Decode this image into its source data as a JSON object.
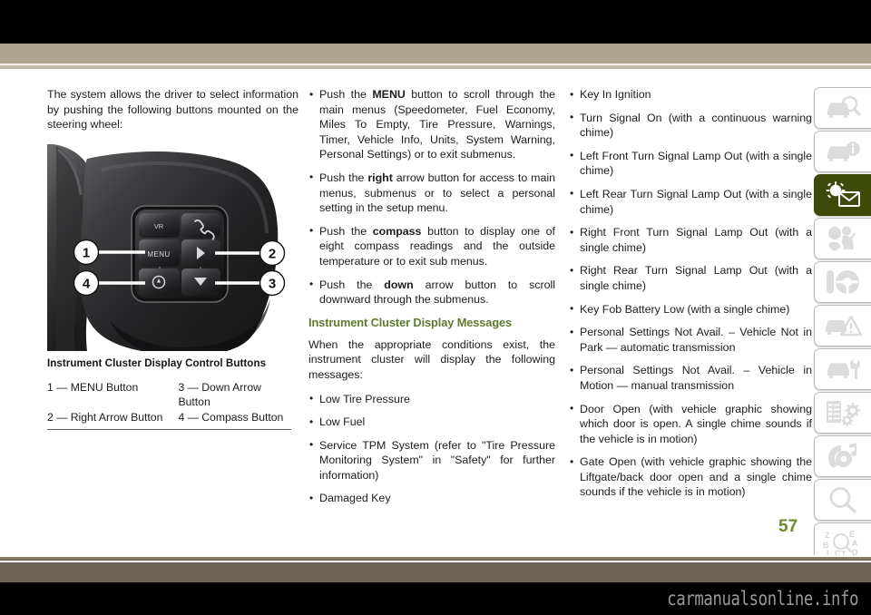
{
  "viewer": {
    "watermark": "carmanualsonline.info",
    "page_number": "57",
    "accent_green": "#5f7a2e",
    "band_color": "#ada592",
    "footer_band_color": "#6c6454",
    "active_tab_color": "#3d4a0a"
  },
  "column1": {
    "intro": "The system allows the driver to select information by pushing the following buttons mounted on the steering wheel:",
    "figure": {
      "alt": "steering-wheel-control-buttons",
      "callouts": [
        "1",
        "2",
        "3",
        "4"
      ],
      "menu_label": "MENU"
    },
    "caption": "Instrument Cluster Display Control Buttons",
    "legend": [
      {
        "left": "1 — MENU Button",
        "right": "3 — Down Arrow Button"
      },
      {
        "left": "2 — Right Arrow Button",
        "right": "4 — Compass Button"
      }
    ]
  },
  "column2": {
    "bullets": [
      {
        "pre": "Push the ",
        "bold": "MENU",
        "post": " button to scroll through the main menus (Speedometer, Fuel Economy, Miles To Empty, Tire Pressure, Warnings, Timer, Vehicle Info, Units, System Warning, Personal Settings) or to exit submenus."
      },
      {
        "pre": "Push the ",
        "bold": "right",
        "post": " arrow button for access to main menus, submenus or to select a personal setting in the setup menu."
      },
      {
        "pre": "Push the ",
        "bold": "compass",
        "post": " button to display one of eight compass readings and the outside temperature or to exit sub menus."
      },
      {
        "pre": "Push the ",
        "bold": "down",
        "post": " arrow button to scroll downward through the submenus."
      }
    ],
    "section_heading": "Instrument Cluster Display Messages",
    "section_intro": "When the appropriate conditions exist, the instrument cluster will display the following messages:",
    "messages": [
      "Low Tire Pressure",
      "Low Fuel",
      "Service TPM System (refer to \"Tire Pressure Monitoring System\" in \"Safety\" for further information)",
      "Damaged Key"
    ]
  },
  "column3": {
    "messages": [
      "Key In Ignition",
      "Turn Signal On (with a continuous warning chime)",
      "Left Front Turn Signal Lamp Out (with a single chime)",
      "Left Rear Turn Signal Lamp Out (with a single chime)",
      "Right Front Turn Signal Lamp Out (with a single chime)",
      "Right Rear Turn Signal Lamp Out (with a single chime)",
      "Key Fob Battery Low (with a single chime)",
      "Personal Settings Not Avail. – Vehicle Not in Park — automatic transmission",
      "Personal Settings Not Avail. – Vehicle in Motion — manual transmission",
      "Door Open (with vehicle graphic showing which door is open. A single chime sounds if the vehicle is in motion)",
      "Gate Open (with vehicle graphic showing the Liftgate/back door open and a single chime sounds if the vehicle is in motion)"
    ]
  },
  "rail": {
    "tabs": [
      {
        "icon": "car-inspect-icon",
        "active": false
      },
      {
        "icon": "car-info-icon",
        "active": false
      },
      {
        "icon": "warning-lights-mail-icon",
        "active": true
      },
      {
        "icon": "occupant-safety-icon",
        "active": false
      },
      {
        "icon": "key-steering-wheel-icon",
        "active": false
      },
      {
        "icon": "car-hazard-icon",
        "active": false
      },
      {
        "icon": "car-service-icon",
        "active": false
      },
      {
        "icon": "specs-gears-icon",
        "active": false
      },
      {
        "icon": "multimedia-icon",
        "active": false
      },
      {
        "icon": "search-icon",
        "active": false
      },
      {
        "icon": "index-alphabet-icon",
        "active": false
      }
    ]
  }
}
